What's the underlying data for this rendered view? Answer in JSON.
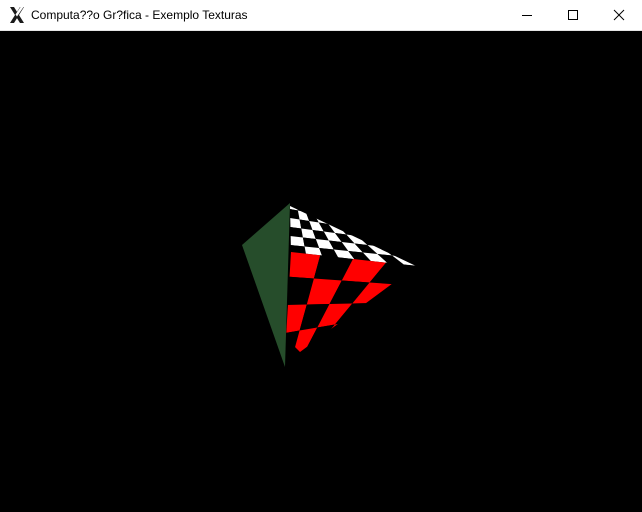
{
  "window": {
    "title": "Computa??o Gr?fica - Exemplo Texturas",
    "icon": "x-logo-icon",
    "controls": {
      "minimize": "minimize-icon",
      "maximize": "maximize-icon",
      "close": "close-icon"
    }
  },
  "scene": {
    "background": "#000000",
    "colors": {
      "green_face": "#264d2b",
      "red_tile": "#ff0000",
      "white_tile": "#ffffff",
      "black_tile": "#000000"
    }
  }
}
